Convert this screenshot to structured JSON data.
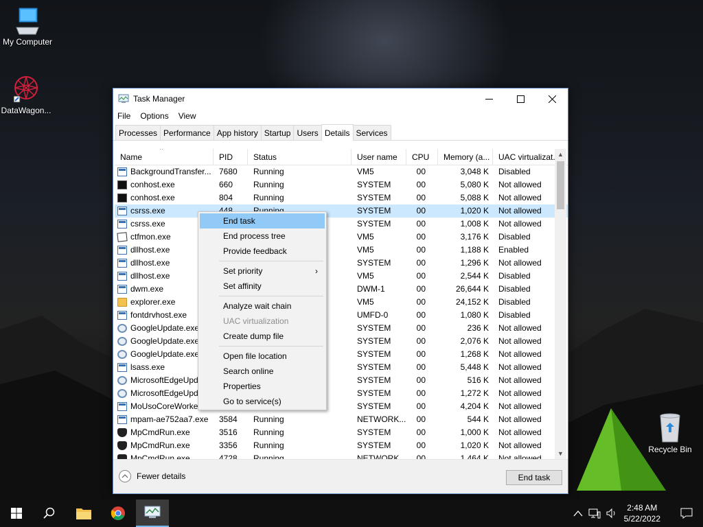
{
  "desktop": {
    "icons": [
      {
        "label": "My Computer",
        "icon": "computer-icon"
      },
      {
        "label": "DataWagon...",
        "icon": "datawagon-icon"
      },
      {
        "label": "Recycle Bin",
        "icon": "recycle-bin-icon"
      }
    ]
  },
  "window": {
    "title": "Task Manager",
    "menu": [
      "File",
      "Options",
      "View"
    ],
    "tabs": [
      "Processes",
      "Performance",
      "App history",
      "Startup",
      "Users",
      "Details",
      "Services"
    ],
    "active_tab": "Details"
  },
  "table": {
    "columns": [
      "Name",
      "PID",
      "Status",
      "User name",
      "CPU",
      "Memory (a...",
      "UAC virtualizat..."
    ],
    "rows": [
      {
        "name": "BackgroundTransfer...",
        "pid": "7680",
        "status": "Running",
        "user": "VM5",
        "cpu": "00",
        "mem": "3,048 K",
        "uac": "Disabled",
        "icon": "window"
      },
      {
        "name": "conhost.exe",
        "pid": "660",
        "status": "Running",
        "user": "SYSTEM",
        "cpu": "00",
        "mem": "5,080 K",
        "uac": "Not allowed",
        "icon": "console"
      },
      {
        "name": "conhost.exe",
        "pid": "804",
        "status": "Running",
        "user": "SYSTEM",
        "cpu": "00",
        "mem": "5,088 K",
        "uac": "Not allowed",
        "icon": "console"
      },
      {
        "name": "csrss.exe",
        "pid": "448",
        "status": "Running",
        "user": "SYSTEM",
        "cpu": "00",
        "mem": "1,020 K",
        "uac": "Not allowed",
        "icon": "window",
        "selected": true
      },
      {
        "name": "csrss.exe",
        "pid": "",
        "status": "",
        "user": "SYSTEM",
        "cpu": "00",
        "mem": "1,008 K",
        "uac": "Not allowed",
        "icon": "window"
      },
      {
        "name": "ctfmon.exe",
        "pid": "",
        "status": "",
        "user": "VM5",
        "cpu": "00",
        "mem": "3,176 K",
        "uac": "Disabled",
        "icon": "note"
      },
      {
        "name": "dllhost.exe",
        "pid": "",
        "status": "",
        "user": "VM5",
        "cpu": "00",
        "mem": "1,188 K",
        "uac": "Enabled",
        "icon": "window"
      },
      {
        "name": "dllhost.exe",
        "pid": "",
        "status": "",
        "user": "SYSTEM",
        "cpu": "00",
        "mem": "1,296 K",
        "uac": "Not allowed",
        "icon": "window"
      },
      {
        "name": "dllhost.exe",
        "pid": "",
        "status": "",
        "user": "VM5",
        "cpu": "00",
        "mem": "2,544 K",
        "uac": "Disabled",
        "icon": "window"
      },
      {
        "name": "dwm.exe",
        "pid": "",
        "status": "",
        "user": "DWM-1",
        "cpu": "00",
        "mem": "26,644 K",
        "uac": "Disabled",
        "icon": "window"
      },
      {
        "name": "explorer.exe",
        "pid": "",
        "status": "",
        "user": "VM5",
        "cpu": "00",
        "mem": "24,152 K",
        "uac": "Disabled",
        "icon": "folder"
      },
      {
        "name": "fontdrvhost.exe",
        "pid": "",
        "status": "",
        "user": "UMFD-0",
        "cpu": "00",
        "mem": "1,080 K",
        "uac": "Disabled",
        "icon": "window"
      },
      {
        "name": "GoogleUpdate.exe",
        "pid": "",
        "status": "",
        "user": "SYSTEM",
        "cpu": "00",
        "mem": "236 K",
        "uac": "Not allowed",
        "icon": "google"
      },
      {
        "name": "GoogleUpdate.exe",
        "pid": "",
        "status": "",
        "user": "SYSTEM",
        "cpu": "00",
        "mem": "2,076 K",
        "uac": "Not allowed",
        "icon": "google"
      },
      {
        "name": "GoogleUpdate.exe",
        "pid": "",
        "status": "",
        "user": "SYSTEM",
        "cpu": "00",
        "mem": "1,268 K",
        "uac": "Not allowed",
        "icon": "google"
      },
      {
        "name": "lsass.exe",
        "pid": "",
        "status": "",
        "user": "SYSTEM",
        "cpu": "00",
        "mem": "5,448 K",
        "uac": "Not allowed",
        "icon": "window"
      },
      {
        "name": "MicrosoftEdgeUpda",
        "pid": "",
        "status": "",
        "user": "SYSTEM",
        "cpu": "00",
        "mem": "516 K",
        "uac": "Not allowed",
        "icon": "google"
      },
      {
        "name": "MicrosoftEdgeUpda",
        "pid": "",
        "status": "",
        "user": "SYSTEM",
        "cpu": "00",
        "mem": "1,272 K",
        "uac": "Not allowed",
        "icon": "google"
      },
      {
        "name": "MoUsoCoreWorker",
        "pid": "",
        "status": "",
        "user": "SYSTEM",
        "cpu": "00",
        "mem": "4,204 K",
        "uac": "Not allowed",
        "icon": "window"
      },
      {
        "name": "mpam-ae752aa7.exe",
        "pid": "3584",
        "status": "Running",
        "user": "NETWORK...",
        "cpu": "00",
        "mem": "544 K",
        "uac": "Not allowed",
        "icon": "window"
      },
      {
        "name": "MpCmdRun.exe",
        "pid": "3516",
        "status": "Running",
        "user": "SYSTEM",
        "cpu": "00",
        "mem": "1,000 K",
        "uac": "Not allowed",
        "icon": "shield"
      },
      {
        "name": "MpCmdRun.exe",
        "pid": "3356",
        "status": "Running",
        "user": "SYSTEM",
        "cpu": "00",
        "mem": "1,020 K",
        "uac": "Not allowed",
        "icon": "shield"
      },
      {
        "name": "MpCmdRun.exe",
        "pid": "4728",
        "status": "Running",
        "user": "NETWORK...",
        "cpu": "00",
        "mem": "1,464 K",
        "uac": "Not allowed",
        "icon": "shield"
      }
    ]
  },
  "context_menu": [
    {
      "label": "End task",
      "highlighted": true
    },
    {
      "label": "End process tree"
    },
    {
      "label": "Provide feedback"
    },
    {
      "sep": true
    },
    {
      "label": "Set priority",
      "submenu": true
    },
    {
      "label": "Set affinity"
    },
    {
      "sep": true
    },
    {
      "label": "Analyze wait chain"
    },
    {
      "label": "UAC virtualization",
      "disabled": true
    },
    {
      "label": "Create dump file"
    },
    {
      "sep": true
    },
    {
      "label": "Open file location"
    },
    {
      "label": "Search online"
    },
    {
      "label": "Properties"
    },
    {
      "label": "Go to service(s)"
    }
  ],
  "footer": {
    "fewer_details": "Fewer details",
    "end_task": "End task"
  },
  "taskbar": {
    "time": "2:48 AM",
    "date": "5/22/2022"
  },
  "colors": {
    "selection": "#cce8ff",
    "menu_highlight": "#91c9f7",
    "taskbar": "#101010"
  }
}
